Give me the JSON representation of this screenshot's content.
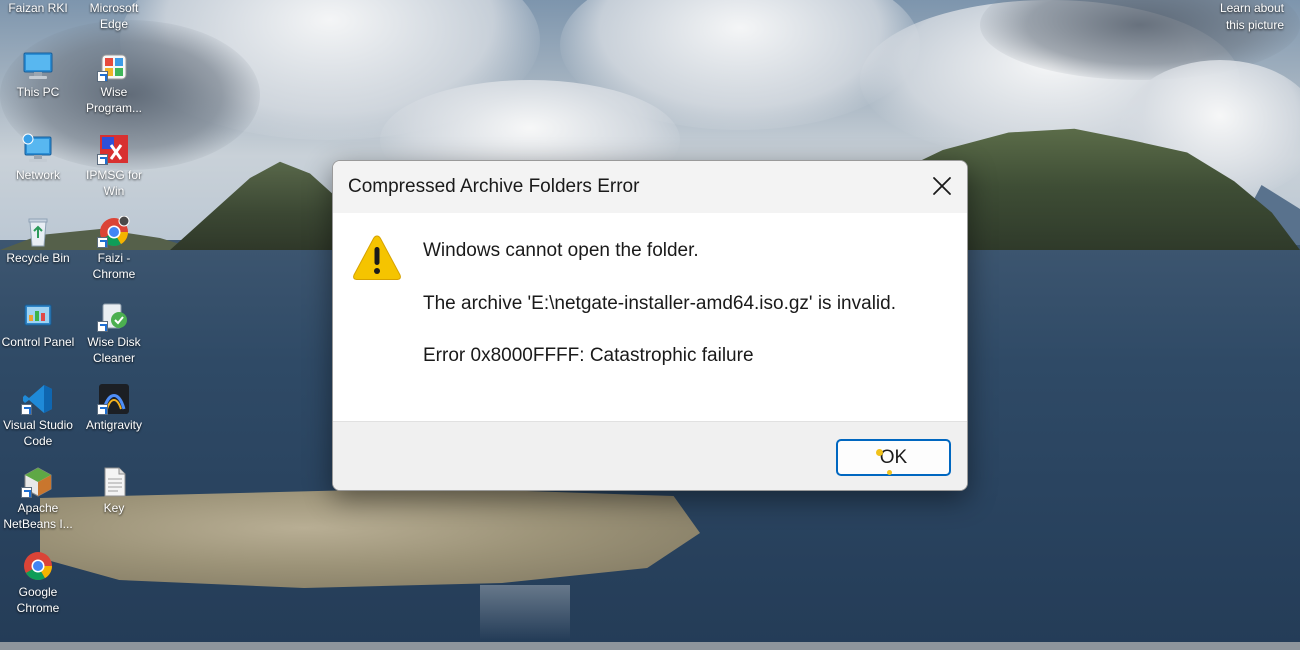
{
  "desktop": {
    "icons": [
      {
        "label": "Faizan RKI"
      },
      {
        "label": "Microsoft Edge"
      },
      {
        "label": "This PC"
      },
      {
        "label": "Wise Program..."
      },
      {
        "label": "Network"
      },
      {
        "label": "IPMSG for Win"
      },
      {
        "label": "Recycle Bin"
      },
      {
        "label": "Faizi - Chrome"
      },
      {
        "label": "Control Panel"
      },
      {
        "label": "Wise Disk Cleaner"
      },
      {
        "label": "Visual Studio Code"
      },
      {
        "label": "Antigravity"
      },
      {
        "label": "Apache NetBeans I..."
      },
      {
        "label": "Key"
      },
      {
        "label": "Google Chrome"
      }
    ],
    "learn_about": "Learn about this picture"
  },
  "dialog": {
    "title": "Compressed Archive Folders Error",
    "close_icon": "close-icon",
    "warning_icon": "warning-icon",
    "message": "Windows cannot open the folder.",
    "detail": "The archive 'E:\\netgate-installer-amd64.iso.gz' is invalid.",
    "error": "Error 0x8000FFFF: Catastrophic failure",
    "ok_label": "OK"
  },
  "colors": {
    "accent": "#0067c0",
    "warning": "#f5c400",
    "titlebar": "#f3f3f3",
    "footer": "#f0f0f0"
  }
}
